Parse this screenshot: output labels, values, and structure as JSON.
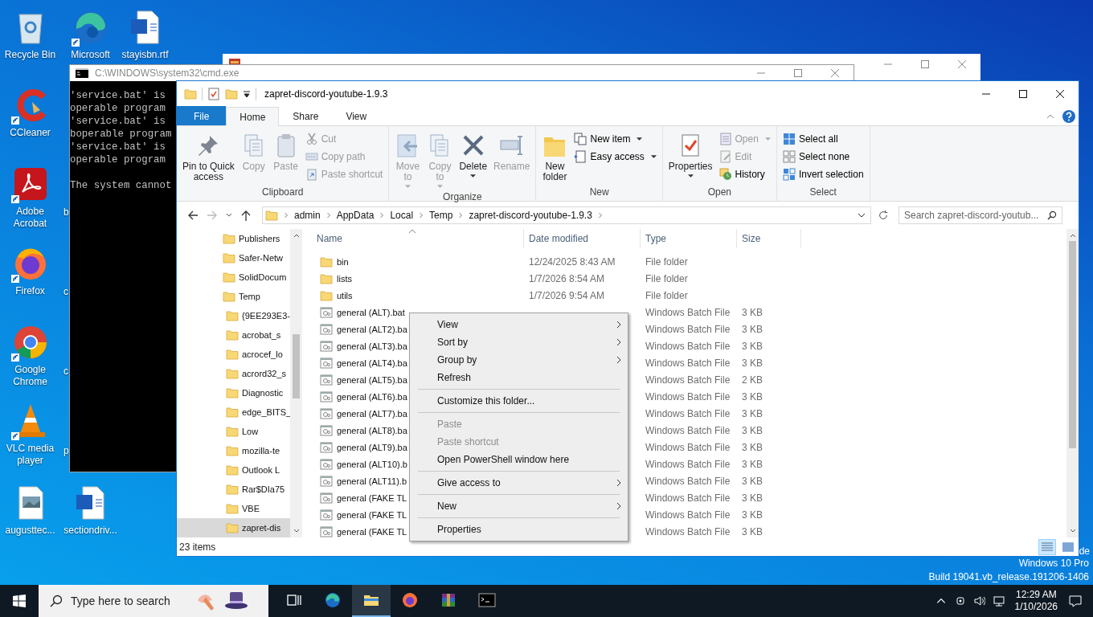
{
  "desktop": {
    "icons": [
      {
        "label": "Recycle Bin",
        "shortcut": false
      },
      {
        "label": "Microsoft",
        "shortcut": true
      },
      {
        "label": "stayisbn.rtf",
        "shortcut": false
      },
      {
        "label": "CCleaner",
        "shortcut": true
      },
      {
        "label": "Adobe Acrobat",
        "shortcut": true
      },
      {
        "label": "Firefox",
        "shortcut": true
      },
      {
        "label": "Google Chrome",
        "shortcut": true
      },
      {
        "label": "VLC media player",
        "shortcut": true
      },
      {
        "label": "augusttec...",
        "shortcut": false
      },
      {
        "label": "sectiondriv...",
        "shortcut": false
      }
    ],
    "partial_labels": [
      "b",
      "c",
      "c",
      "p"
    ],
    "system_watermark": {
      "fragment": "de",
      "edition": "Windows 10 Pro",
      "build": "Build 19041.vb_release.191206-1406"
    }
  },
  "cmd_window": {
    "title": "C:\\WINDOWS\\system32\\cmd.exe",
    "active": false,
    "blocks": [
      [
        "'service.bat' is",
        "operable program",
        "'service.bat' is",
        "boperable program",
        "'service.bat' is",
        "operable program"
      ],
      [
        "The system cannot"
      ]
    ]
  },
  "explorer": {
    "title": "zapret-discord-youtube-1.9.3",
    "tabs": [
      {
        "label": "File",
        "kind": "file",
        "selected": false
      },
      {
        "label": "Home",
        "kind": "tab",
        "selected": true
      },
      {
        "label": "Share",
        "kind": "tab",
        "selected": false
      },
      {
        "label": "View",
        "kind": "tab",
        "selected": false
      }
    ],
    "ribbon": [
      {
        "label": "Clipboard",
        "large": [
          {
            "label": "Pin to Quick\naccess",
            "disabled": false,
            "dropdown": false
          },
          {
            "label": "Copy",
            "disabled": true,
            "dropdown": false
          },
          {
            "label": "Paste",
            "disabled": true,
            "dropdown": false
          }
        ],
        "small": [
          {
            "label": "Cut",
            "disabled": true,
            "dropdown": false
          },
          {
            "label": "Copy path",
            "disabled": true,
            "dropdown": false
          },
          {
            "label": "Paste shortcut",
            "disabled": true,
            "dropdown": false
          }
        ]
      },
      {
        "label": "Organize",
        "large": [
          {
            "label": "Move\nto",
            "disabled": true,
            "dropdown": true
          },
          {
            "label": "Copy\nto",
            "disabled": true,
            "dropdown": true
          },
          {
            "label": "Delete",
            "disabled": false,
            "dropdown": true
          },
          {
            "label": "Rename",
            "disabled": true,
            "dropdown": false
          }
        ]
      },
      {
        "label": "New",
        "large": [
          {
            "label": "New\nfolder",
            "disabled": false,
            "dropdown": false
          }
        ],
        "small": [
          {
            "label": "New item",
            "disabled": false,
            "dropdown": true
          },
          {
            "label": "Easy access",
            "disabled": false,
            "dropdown": true
          }
        ]
      },
      {
        "label": "Open",
        "large": [
          {
            "label": "Properties",
            "disabled": false,
            "dropdown": true
          }
        ],
        "small": [
          {
            "label": "Open",
            "disabled": true,
            "dropdown": true
          },
          {
            "label": "Edit",
            "disabled": true,
            "dropdown": false
          },
          {
            "label": "History",
            "disabled": false,
            "dropdown": false
          }
        ]
      },
      {
        "label": "Select",
        "small": [
          {
            "label": "Select all",
            "disabled": false,
            "dropdown": false
          },
          {
            "label": "Select none",
            "disabled": false,
            "dropdown": false
          },
          {
            "label": "Invert selection",
            "disabled": false,
            "dropdown": false
          }
        ]
      }
    ],
    "address": {
      "crumbs": [
        "admin",
        "AppData",
        "Local",
        "Temp",
        "zapret-discord-youtube-1.9.3"
      ]
    },
    "search": {
      "placeholder": "Search zapret-discord-youtub..."
    },
    "nav": [
      {
        "label": "Publishers",
        "selected": false
      },
      {
        "label": "Safer-Netw",
        "selected": false
      },
      {
        "label": "SolidDocum",
        "selected": false
      },
      {
        "label": "Temp",
        "selected": false,
        "children": [
          {
            "label": "{9EE293E3-",
            "selected": false
          },
          {
            "label": "acrobat_s",
            "selected": false
          },
          {
            "label": "acrocef_lo",
            "selected": false
          },
          {
            "label": "acrord32_s",
            "selected": false
          },
          {
            "label": "Diagnostic",
            "selected": false
          },
          {
            "label": "edge_BITS_",
            "selected": false
          },
          {
            "label": "Low",
            "selected": false
          },
          {
            "label": "mozilla-te",
            "selected": false
          },
          {
            "label": "Outlook L",
            "selected": false
          },
          {
            "label": "Rar$DIa75",
            "selected": false
          },
          {
            "label": "VBE",
            "selected": false
          },
          {
            "label": "zapret-dis",
            "selected": true
          }
        ]
      }
    ],
    "columns": [
      "Name",
      "Date modified",
      "Type",
      "Size"
    ],
    "rows": [
      {
        "name": "bin",
        "kind": "folder",
        "date": "12/24/2025 8:43 AM",
        "type": "File folder"
      },
      {
        "name": "lists",
        "kind": "folder",
        "date": "1/7/2026 8:54 AM",
        "type": "File folder"
      },
      {
        "name": "utils",
        "kind": "folder",
        "date": "1/7/2026 9:54 AM",
        "type": "File folder"
      },
      {
        "name": "general (ALT).bat",
        "kind": "batch",
        "type": "Windows Batch File",
        "size": "3 KB"
      },
      {
        "name": "general (ALT2).ba",
        "kind": "batch",
        "type": "Windows Batch File",
        "size": "3 KB"
      },
      {
        "name": "general (ALT3).ba",
        "kind": "batch",
        "type": "Windows Batch File",
        "size": "3 KB"
      },
      {
        "name": "general (ALT4).ba",
        "kind": "batch",
        "type": "Windows Batch File",
        "size": "3 KB"
      },
      {
        "name": "general (ALT5).ba",
        "kind": "batch",
        "type": "Windows Batch File",
        "size": "2 KB"
      },
      {
        "name": "general (ALT6).ba",
        "kind": "batch",
        "type": "Windows Batch File",
        "size": "3 KB"
      },
      {
        "name": "general (ALT7).ba",
        "kind": "batch",
        "type": "Windows Batch File",
        "size": "3 KB"
      },
      {
        "name": "general (ALT8).ba",
        "kind": "batch",
        "type": "Windows Batch File",
        "size": "3 KB"
      },
      {
        "name": "general (ALT9).ba",
        "kind": "batch",
        "type": "Windows Batch File",
        "size": "3 KB"
      },
      {
        "name": "general (ALT10).b",
        "kind": "batch",
        "type": "Windows Batch File",
        "size": "3 KB"
      },
      {
        "name": "general (ALT11).b",
        "kind": "batch",
        "type": "Windows Batch File",
        "size": "3 KB"
      },
      {
        "name": "general (FAKE TL",
        "kind": "batch",
        "type": "Windows Batch File",
        "size": "3 KB"
      },
      {
        "name": "general (FAKE TL",
        "kind": "batch",
        "type": "Windows Batch File",
        "size": "3 KB"
      },
      {
        "name": "general (FAKE TL",
        "kind": "batch",
        "type": "Windows Batch File",
        "size": "3 KB"
      }
    ],
    "status": "23 items",
    "view_buttons": [
      {
        "selected": true
      },
      {
        "selected": false
      }
    ]
  },
  "context_menu": [
    {
      "kind": "item",
      "label": "View",
      "submenu": true,
      "disabled": false
    },
    {
      "kind": "item",
      "label": "Sort by",
      "submenu": true,
      "disabled": false
    },
    {
      "kind": "item",
      "label": "Group by",
      "submenu": true,
      "disabled": false
    },
    {
      "kind": "item",
      "label": "Refresh",
      "submenu": false,
      "disabled": false
    },
    {
      "kind": "separator"
    },
    {
      "kind": "item",
      "label": "Customize this folder...",
      "submenu": false,
      "disabled": false
    },
    {
      "kind": "separator"
    },
    {
      "kind": "item",
      "label": "Paste",
      "submenu": false,
      "disabled": true
    },
    {
      "kind": "item",
      "label": "Paste shortcut",
      "submenu": false,
      "disabled": true
    },
    {
      "kind": "item",
      "label": "Open PowerShell window here",
      "submenu": false,
      "disabled": false
    },
    {
      "kind": "separator"
    },
    {
      "kind": "item",
      "label": "Give access to",
      "submenu": true,
      "disabled": false
    },
    {
      "kind": "separator"
    },
    {
      "kind": "item",
      "label": "New",
      "submenu": true,
      "disabled": false
    },
    {
      "kind": "separator"
    },
    {
      "kind": "item",
      "label": "Properties",
      "submenu": false,
      "disabled": false
    }
  ],
  "taskbar": {
    "search": {
      "placeholder": "Type here to search"
    },
    "apps": [
      {
        "active": false
      },
      {
        "active": false
      },
      {
        "active": true
      },
      {
        "active": false
      },
      {
        "active": false
      },
      {
        "active": false
      }
    ],
    "clock": {
      "time": "12:29 AM",
      "date": "1/10/2026"
    }
  }
}
